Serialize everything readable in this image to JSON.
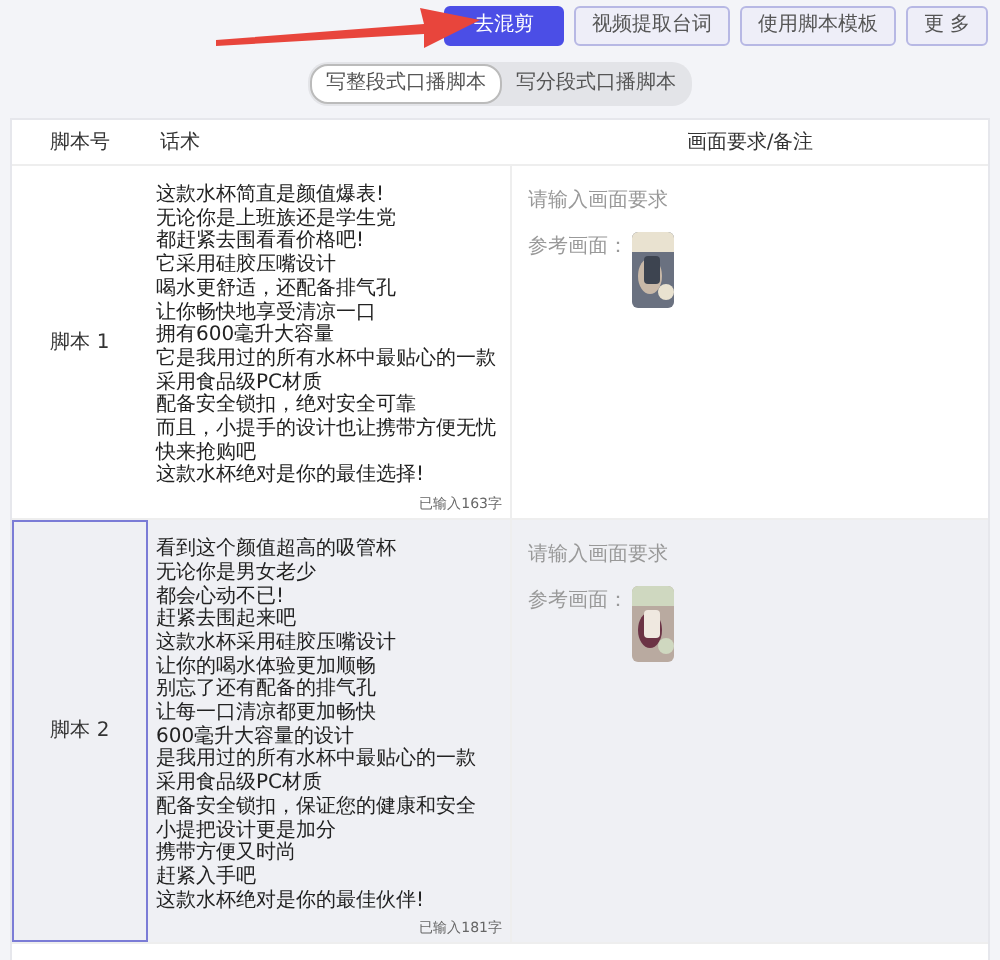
{
  "toolbar": {
    "buttons": [
      {
        "label": "去混剪",
        "kind": "primary"
      },
      {
        "label": "视频提取台词",
        "kind": "outline"
      },
      {
        "label": "使用脚本模板",
        "kind": "outline"
      },
      {
        "label": "更 多",
        "kind": "outline"
      }
    ]
  },
  "mode_tabs": [
    {
      "label": "写整段式口播脚本",
      "selected": true
    },
    {
      "label": "写分段式口播脚本",
      "selected": false
    }
  ],
  "table": {
    "columns": [
      "脚本号",
      "话术",
      "画面要求/备注"
    ],
    "rows": [
      {
        "number": "脚本 1",
        "selected": false,
        "hovered": false,
        "lines": [
          "这款水杯简直是颜值爆表!",
          "无论你是上班族还是学生党",
          "都赶紧去围看看价格吧!",
          "它采用硅胶压嘴设计",
          "喝水更舒适，还配备排气孔",
          "让你畅快地享受清凉一口",
          "拥有600毫升大容量",
          "它是我用过的所有水杯中最贴心的一款",
          "采用食品级PC材质",
          "配备安全锁扣，绝对安全可靠",
          "而且，小提手的设计也让携带方便无忧",
          "快来抢购吧",
          "这款水杯绝对是你的最佳选择!"
        ],
        "count": "已输入163字",
        "placeholder": "请输入画面要求",
        "reference_label": "参考画面："
      },
      {
        "number": "脚本 2",
        "selected": true,
        "hovered": true,
        "lines": [
          "看到这个颜值超高的吸管杯",
          "无论你是男女老少",
          "都会心动不已!",
          "赶紧去围起来吧",
          "这款水杯采用硅胶压嘴设计",
          "让你的喝水体验更加顺畅",
          "别忘了还有配备的排气孔",
          "让每一口清凉都更加畅快",
          "600毫升大容量的设计",
          "是我用过的所有水杯中最贴心的一款",
          "采用食品级PC材质",
          "配备安全锁扣，保证您的健康和安全",
          "小提把设计更是加分",
          "携带方便又时尚",
          "赶紧入手吧",
          "这款水杯绝对是你的最佳伙伴!"
        ],
        "count": "已输入181字",
        "placeholder": "请输入画面要求",
        "reference_label": "参考画面："
      }
    ]
  }
}
